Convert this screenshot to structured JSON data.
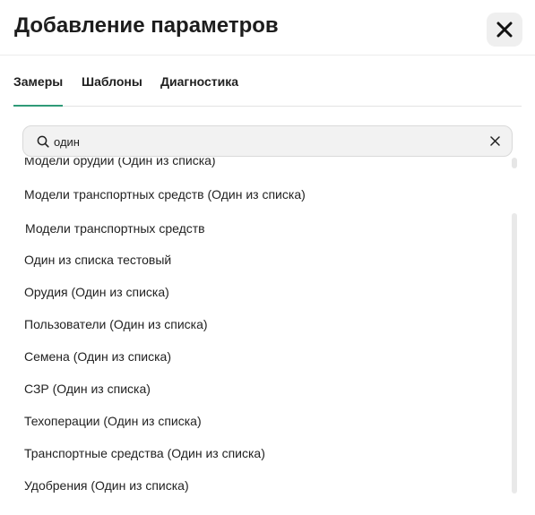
{
  "dialog": {
    "title": "Добавление параметров",
    "close_icon": "close-x-icon"
  },
  "tabs": [
    {
      "label": "Замеры",
      "active": true
    },
    {
      "label": "Шаблоны",
      "active": false
    },
    {
      "label": "Диагностика",
      "active": false
    }
  ],
  "search": {
    "icon": "search-icon",
    "value": "один",
    "placeholder": "",
    "clear_icon": "clear-x-icon"
  },
  "list": {
    "items": [
      "Модели орудий (Один из списка)",
      "Модели транспортных средств (Один из списка)",
      "Модели транспортных средств",
      "Один из списка тестовый",
      "Орудия (Один из списка)",
      "Пользователи (Один из списка)",
      "Семена (Один из списка)",
      "СЗР (Один из списка)",
      "Техоперации (Один из списка)",
      "Транспортные средства (Один из списка)",
      "Удобрения (Один из списка)"
    ]
  },
  "colors": {
    "accent": "#2f9a78",
    "search_background": "#f2f2f2",
    "close_button_background": "#efefef"
  }
}
